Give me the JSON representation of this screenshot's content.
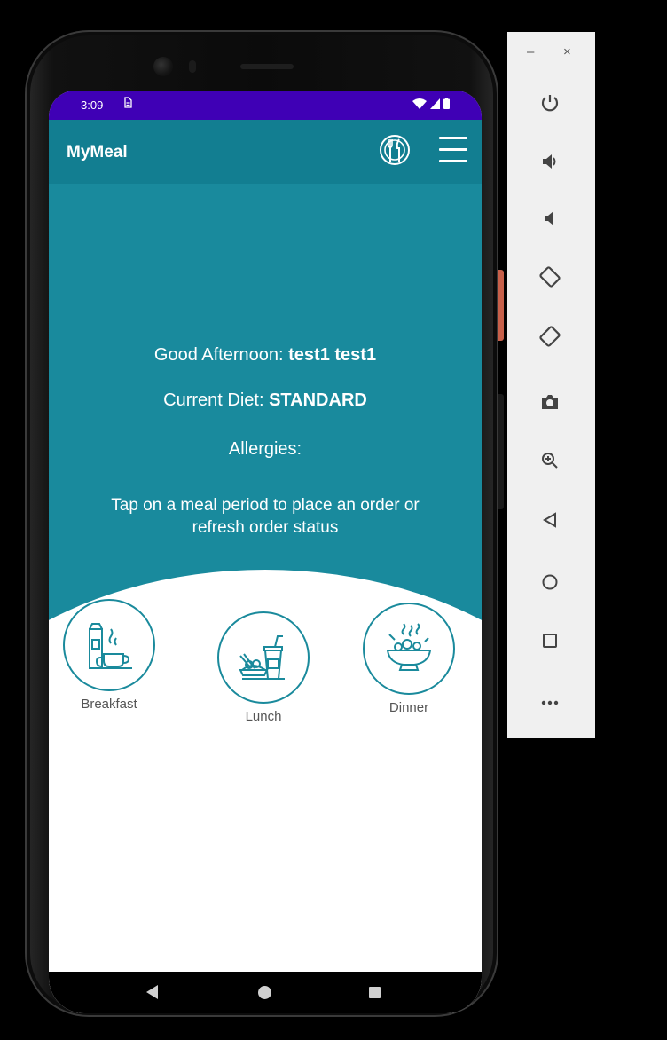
{
  "status_bar": {
    "time": "3:09",
    "sim_icon": "sim-card-icon",
    "icons": [
      "wifi-icon",
      "signal-icon",
      "battery-icon"
    ]
  },
  "app_bar": {
    "title": "MyMeal",
    "meal_icon": "plate-cutlery-icon",
    "menu_icon": "hamburger-menu-icon"
  },
  "hero": {
    "greeting_prefix": "Good Afternoon: ",
    "user_name": "test1 test1",
    "diet_prefix": "Current Diet: ",
    "diet_value": "STANDARD",
    "allergies_label": "Allergies:",
    "instruction": "Tap on a meal period to place an order or refresh order status"
  },
  "meals": [
    {
      "label": "Breakfast",
      "icon": "breakfast-icon"
    },
    {
      "label": "Lunch",
      "icon": "lunch-icon"
    },
    {
      "label": "Dinner",
      "icon": "dinner-icon"
    }
  ],
  "nav_bar": {
    "icons": [
      "back-icon",
      "home-icon",
      "recent-apps-icon"
    ]
  },
  "emulator_toolbar": {
    "minimize_label": "–",
    "close_label": "×",
    "tools": [
      "power-icon",
      "volume-up-icon",
      "volume-down-icon",
      "rotate-left-icon",
      "rotate-right-icon",
      "camera-icon",
      "zoom-icon",
      "back-icon",
      "home-icon",
      "overview-icon",
      "more-icon"
    ]
  },
  "colors": {
    "status_bar": "#3f00b5",
    "app_bar": "#127e91",
    "hero": "#198a9d",
    "accent": "#1a8a9c"
  }
}
